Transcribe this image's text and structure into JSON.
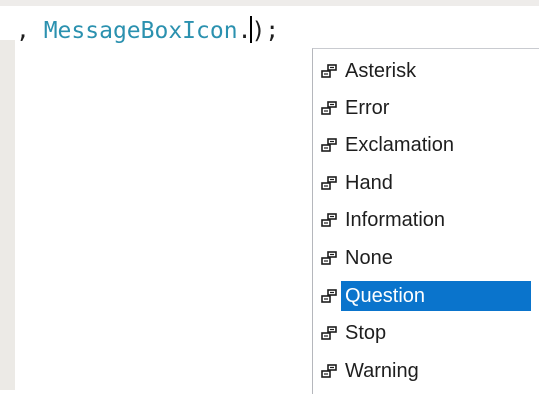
{
  "editor": {
    "code_prefix": ", ",
    "type_name": "MessageBoxIcon",
    "dot": ".",
    "code_suffix": ");"
  },
  "completion": {
    "icon": "enum-member-icon",
    "accent_color": "#0a74cc",
    "selected_index": 6,
    "items": [
      {
        "label": "Asterisk"
      },
      {
        "label": "Error"
      },
      {
        "label": "Exclamation"
      },
      {
        "label": "Hand"
      },
      {
        "label": "Information"
      },
      {
        "label": "None"
      },
      {
        "label": "Question"
      },
      {
        "label": "Stop"
      },
      {
        "label": "Warning"
      }
    ]
  }
}
